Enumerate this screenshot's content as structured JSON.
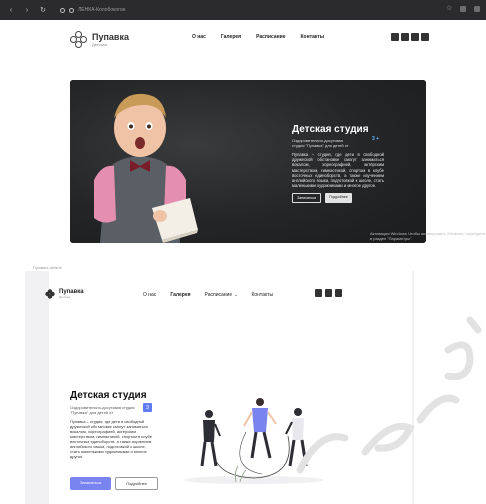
{
  "browser": {
    "address": "ЛЕНКА-Колобокогое",
    "window_icons": [
      "back-icon",
      "forward-icon",
      "reload-icon"
    ]
  },
  "site_top": {
    "logo": {
      "name": "Пупавка",
      "subtitle": "Детская"
    },
    "nav": [
      "О нас",
      "Галерея",
      "Расписание",
      "Контакты"
    ],
    "social_icons": [
      "vk-icon",
      "instagram-icon",
      "youtube-icon",
      "telegram-icon"
    ],
    "hero": {
      "title": "Детская студия",
      "tagline": "Оздоровительно-досуговая студия \"Пупавка\" для детей от",
      "number": "3 +",
      "description": "Пупавка – студия, где дети в свободной дружеской обстановке смогут заниматься вокалом, хореографией, актёрским мастерством, гимнастикой, спортом в клубе восточных единоборств, а также изучением английского языка, подготовкой к школе, стать маленькими художниками и многое другое.",
      "btn_primary": "Записаться",
      "btn_secondary": "Подробнее"
    },
    "watermark": "Активация Windows\nЧтобы активировать Windows, перейдите в раздел \"Параметры\""
  },
  "site_bottom": {
    "frame_label": "Пупавка default",
    "logo": {
      "name": "Пупавка",
      "subtitle": "Детская"
    },
    "nav": [
      "О нас",
      "Галерея",
      "Расписание",
      "Контакты"
    ],
    "nav_active": "Галерея",
    "social_icons": [
      "telegram-icon",
      "instagram-icon",
      "vk-icon"
    ],
    "hero": {
      "title": "Детская студия",
      "tagline": "Оздоровительно-досуговая студия \"Пупавка\" для детей от",
      "number": "3",
      "description": "Пупавка – студия, где дети в свободной дружеской обстановке смогут заниматься вокалом, хореографией, актёрским мастерством, гимнастикой, спортом в клубе восточных единоборств, а также изучением английского языка, подготовкой к школе, стать маленькими художниками и многое другое.",
      "btn_primary": "Записаться",
      "btn_secondary": "Подробнее"
    }
  },
  "colors": {
    "accent": "#7a84f0",
    "hero_bg": "#27282a",
    "browser_bar": "#2b2b2e"
  }
}
